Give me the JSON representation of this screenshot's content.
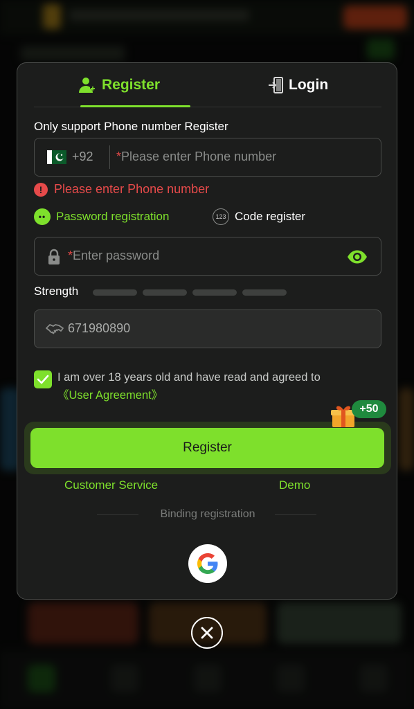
{
  "tabs": {
    "register_label": "Register",
    "login_label": "Login"
  },
  "form": {
    "support_label": "Only support Phone number Register",
    "dial_code": "+92",
    "phone_placeholder": "Please enter Phone number",
    "phone_error": "Please enter Phone number",
    "mode_password": "Password registration",
    "mode_code": "Code register",
    "password_placeholder": "Enter password",
    "strength_label": "Strength",
    "strength_bars_filled": 0,
    "invite_code": "671980890",
    "agree_text": "I am over 18 years old and have read and agreed to",
    "agreement_link": "《User Agreement》",
    "agree_checked": true,
    "register_button": "Register",
    "bonus": "+50"
  },
  "links": {
    "customer_service": "Customer Service",
    "demo": "Demo",
    "binding_registration": "Binding registration"
  },
  "icons": {
    "register_tab": "add-user-icon",
    "login_tab": "login-door-icon",
    "flag": "pakistan-flag-icon",
    "error": "exclamation-icon",
    "password_mode": "dots-icon",
    "code_mode": "numbers-123-icon",
    "password": "lock-icon",
    "visibility": "eye-icon",
    "invite": "handshake-icon",
    "gift": "gift-icon",
    "google": "google-icon",
    "close": "close-icon"
  },
  "colors": {
    "accent": "#7ee02c",
    "error": "#e64a4a",
    "modal_bg": "#1c1d1c"
  }
}
